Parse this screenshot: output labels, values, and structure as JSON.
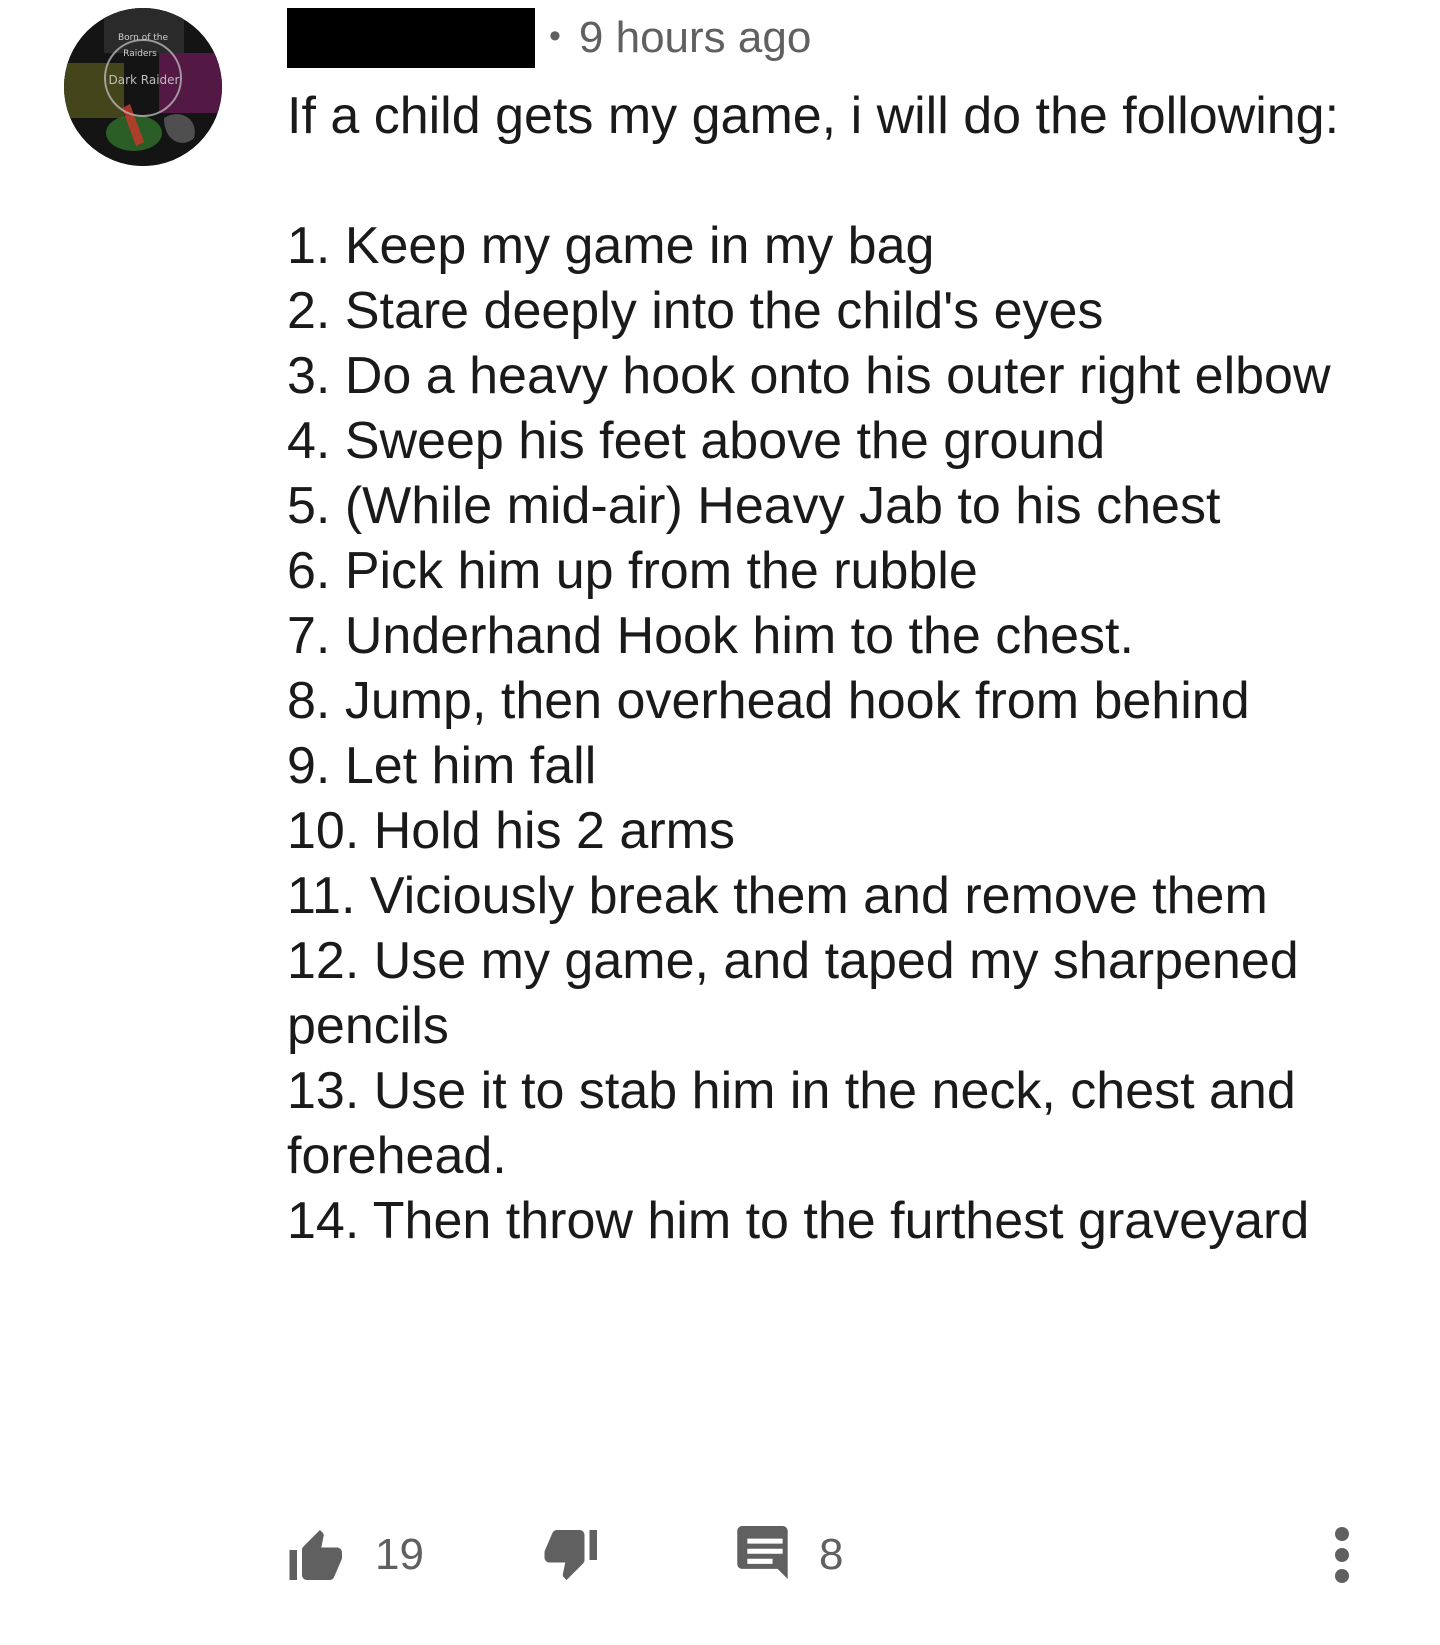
{
  "comment": {
    "timestamp": "9 hours ago",
    "separator": "•",
    "intro": "If a child gets my game, i will do the following:",
    "steps": [
      "1. Keep my game in my bag",
      "2. Stare deeply into the child's eyes",
      "3. Do a heavy hook onto his outer right elbow",
      "4. Sweep his feet above the ground",
      "5. (While mid-air) Heavy Jab to his chest",
      "6. Pick him up from the rubble",
      "7. Underhand Hook him to the chest.",
      "8. Jump, then overhead hook from behind",
      "9. Let him fall",
      "10. Hold his 2 arms",
      "11. Viciously break them and remove them",
      "12. Use my game, and taped my sharpened pencils",
      "13. Use it to stab him in the neck, chest and forehead.",
      "14. Then throw him to the furthest graveyard"
    ],
    "like_count": "19",
    "reply_count": "8",
    "avatar_text": {
      "line1": "Born of the",
      "line2": "Raiders",
      "line3": "Dark Raider"
    }
  },
  "icons": {
    "like": "thumbs-up-icon",
    "dislike": "thumbs-down-icon",
    "reply": "reply-comment-icon",
    "more": "more-vertical-icon"
  },
  "colors": {
    "text": "#1a1a1a",
    "secondary": "#606060",
    "redaction": "#000000",
    "background": "#ffffff"
  }
}
